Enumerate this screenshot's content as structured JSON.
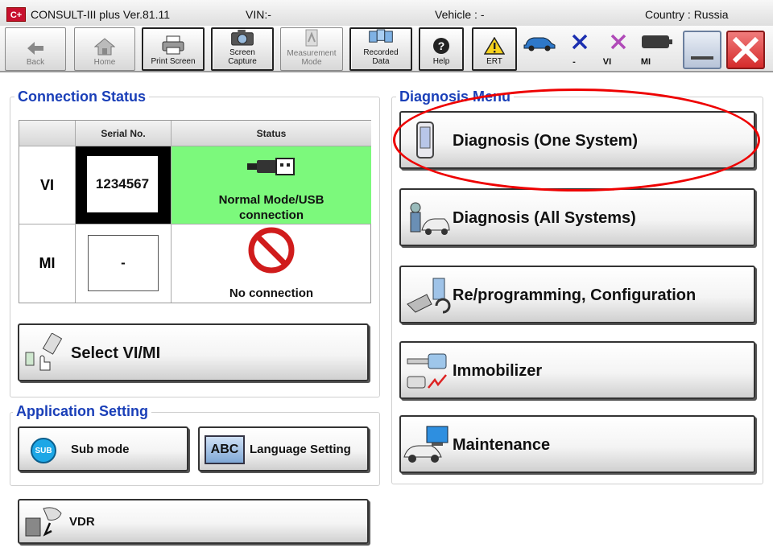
{
  "titlebar": {
    "logo": "C+",
    "app_title": "CONSULT-III plus  Ver.81.11",
    "vin": "VIN:-",
    "vehicle": "Vehicle : -",
    "country": "Country : Russia"
  },
  "toolbar": {
    "back": "Back",
    "home": "Home",
    "print_screen": "Print Screen",
    "screen_capture": "Screen\nCapture",
    "measurement_mode": "Measurement\nMode",
    "recorded_data": "Recorded\nData",
    "help": "Help",
    "ert": "ERT",
    "status_vehicle": "-",
    "status_vi": "VI",
    "status_mi": "MI"
  },
  "connection_status": {
    "title": "Connection Status",
    "col_serial": "Serial No.",
    "col_status": "Status",
    "rows": [
      {
        "label": "VI",
        "serial": "1234567",
        "status": "Normal Mode/USB\nconnection"
      },
      {
        "label": "MI",
        "serial": "-",
        "status": "No connection"
      }
    ],
    "select_button": "Select VI/MI"
  },
  "application_setting": {
    "title": "Application Setting",
    "sub_mode": "Sub mode",
    "sub_icon_text": "SUB",
    "language": "Language Setting",
    "abc_icon_text": "ABC",
    "vdr": "VDR"
  },
  "diagnosis_menu": {
    "title": "Diagnosis Menu",
    "items": [
      {
        "label": "Diagnosis (One System)"
      },
      {
        "label": "Diagnosis (All Systems)"
      },
      {
        "label": "Re/programming, Configuration"
      },
      {
        "label": "Immobilizer"
      },
      {
        "label": "Maintenance"
      }
    ]
  },
  "colors": {
    "title_blue": "#1a3fb8",
    "connected_green": "#7cf97c",
    "highlight_red": "#e00000",
    "close_red": "#d52b2b"
  },
  "icons": [
    "back-arrow-icon",
    "home-icon",
    "printer-icon",
    "camera-icon",
    "measurement-icon",
    "recorded-data-icon",
    "help-icon",
    "warning-icon",
    "car-icon",
    "vi-status-icon",
    "mi-status-icon",
    "battery-icon",
    "minimize-icon",
    "close-icon",
    "usb-icon",
    "no-connection-icon"
  ]
}
